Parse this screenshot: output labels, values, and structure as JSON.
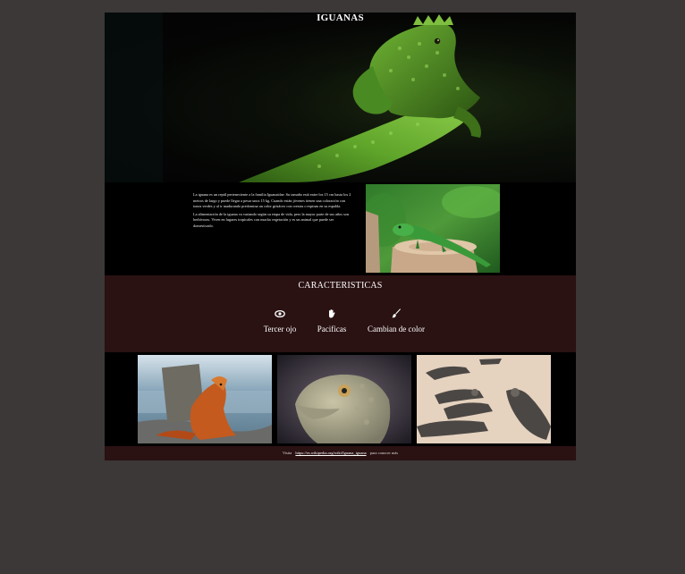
{
  "hero": {
    "title": "IGUANAS",
    "image": "green-iguana-dark-background"
  },
  "intro": {
    "paragraphs": [
      "La iguana es un reptil perteneciente a la familia Iguanaidae. Su tamaño está entre los 15 cm hasta los 2 metros de largo y puede llegar a pesar unos 15 kg. Cuando están jóvenes tienen una coloración con tonos verdes y al ir madurando predomina un color grisáceo con crestas o espinas en su espalda.",
      "La alimentación de la iguana va variando según su etapa de vida, pero la mayor parte de sus años son herbívoras. Viven en lugares tropicales con mucha vegetación y es un animal que puede ser domesticado."
    ],
    "photo": "green-iguana-on-tree-stump"
  },
  "features": {
    "title": "CARACTERISTICAS",
    "items": [
      {
        "label": "Tercer ojo",
        "icon": "eye-icon"
      },
      {
        "label": "Pacificas",
        "icon": "hand-icon"
      },
      {
        "label": "Cambian de color",
        "icon": "paintbrush-icon"
      }
    ]
  },
  "gallery": {
    "images": [
      "orange-iguana-by-sea",
      "gray-iguana-closeup",
      "iguanas-group-on-sand"
    ]
  },
  "footer": {
    "prefix": "Visita",
    "link": "https://es.wikipedia.org/wiki/Iguana_iguana",
    "suffix": "para conocer más"
  },
  "colors": {
    "outer_background": "#3b3837",
    "page_background": "#000000",
    "band_maroon": "#2a1112",
    "text": "#ffffff"
  }
}
